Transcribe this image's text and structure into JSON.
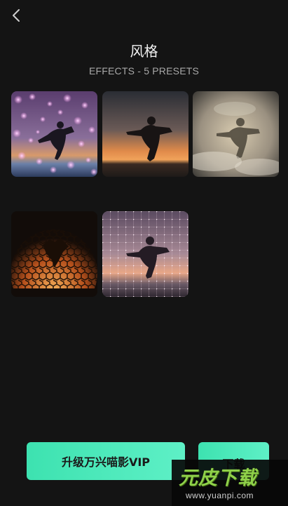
{
  "header": {
    "back_icon": "chevron-left-icon",
    "title": "风格",
    "subtitle": "EFFECTS - 5 PRESETS"
  },
  "presets": [
    {
      "name": "bokeh-sparkle"
    },
    {
      "name": "sunset-silhouette"
    },
    {
      "name": "smoke-fog"
    },
    {
      "name": "hexagon-mosaic"
    },
    {
      "name": "grid-sparkle"
    }
  ],
  "footer": {
    "vip_label": "升级万兴喵影VIP",
    "download_label": "下载"
  },
  "watermark": {
    "brand": "元皮下载",
    "url": "www.yuanpi.com"
  },
  "colors": {
    "background": "#141414",
    "accent": "#4be8bb",
    "watermark_green": "#8fd14a"
  }
}
